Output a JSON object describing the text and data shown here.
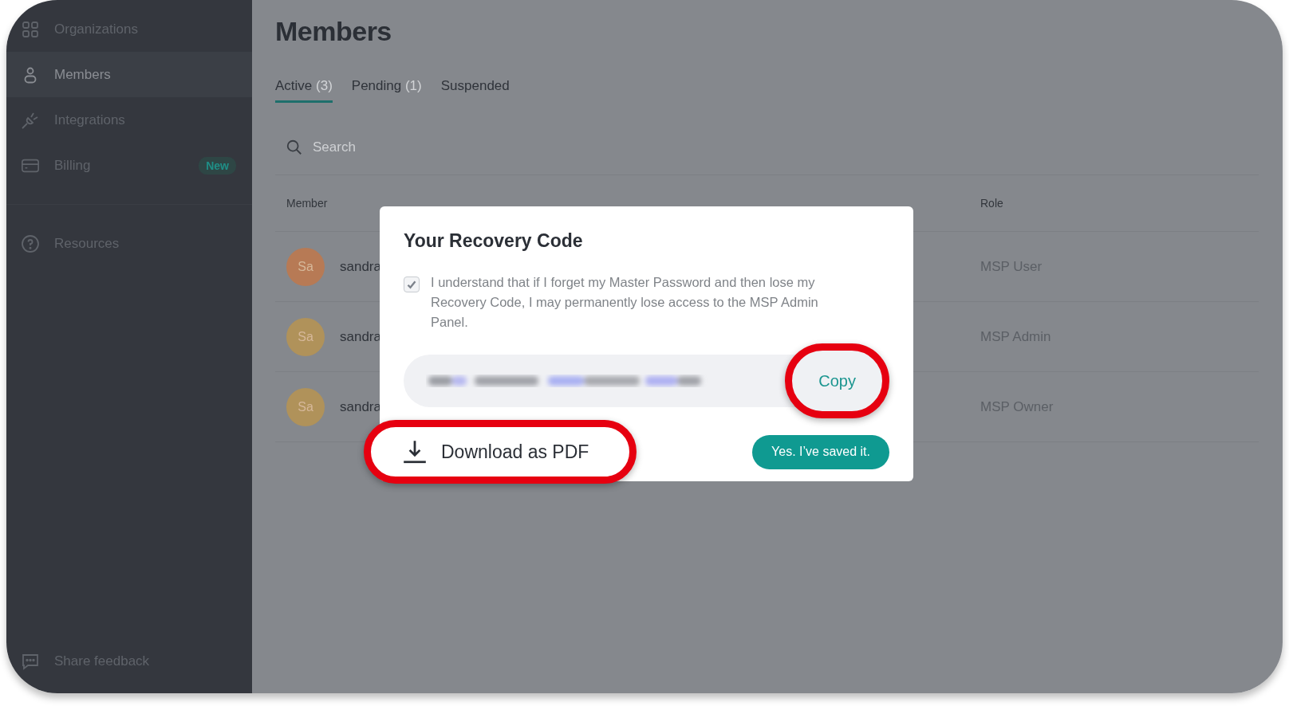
{
  "sidebar": {
    "items": [
      {
        "label": "Organizations",
        "kind": "grid",
        "selected": false
      },
      {
        "label": "Members",
        "kind": "person",
        "selected": true
      },
      {
        "label": "Integrations",
        "kind": "plug",
        "selected": false
      },
      {
        "label": "Billing",
        "kind": "card",
        "selected": false,
        "badge": "New"
      }
    ],
    "resources": {
      "label": "Resources"
    },
    "feedback": {
      "label": "Share feedback"
    }
  },
  "page": {
    "title": "Members",
    "tabs": [
      {
        "label": "Active",
        "count": "(3)",
        "selected": true
      },
      {
        "label": "Pending",
        "count": "(1)",
        "selected": false
      },
      {
        "label": "Suspended",
        "selected": false
      }
    ],
    "search": {
      "placeholder": "Search"
    },
    "table": {
      "columns": [
        "Member",
        "Role"
      ],
      "rows": [
        {
          "avatar": "Sa",
          "color": "#b77a55",
          "name": "sandra",
          "role": "MSP User"
        },
        {
          "avatar": "Sa",
          "color": "#b0925a",
          "name": "sandra",
          "role": "MSP Admin"
        },
        {
          "avatar": "Sa",
          "color": "#b0925a",
          "name": "sandra",
          "role": "MSP Owner"
        }
      ]
    }
  },
  "modal": {
    "title": "Your Recovery Code",
    "agreement": {
      "checked": true,
      "label": "I understand that if I forget my Master Password and then lose my Recovery Code, I may permanently lose access to the MSP Admin Panel."
    },
    "copy_button": {
      "label": "Copy",
      "highlighted": true
    },
    "download_button": {
      "label": "Download as PDF",
      "highlighted": true
    },
    "confirm_button": {
      "label": "Yes. I’ve saved it."
    }
  }
}
